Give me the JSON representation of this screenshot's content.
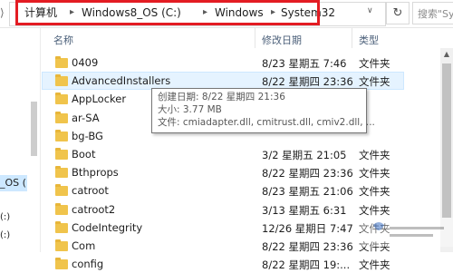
{
  "address_bar": {
    "back_glyph": "⟩",
    "crumbs": [
      "计算机",
      "Windows8_OS (C:)",
      "Windows",
      "System32"
    ],
    "separator": "▸",
    "dropdown_glyph": "∨",
    "refresh_glyph": "↻",
    "search_placeholder": "搜索\"Sy"
  },
  "nav_pane": {
    "drive_label": "_OS (",
    "c_label": "(:)",
    "d_label": "(:)"
  },
  "columns": {
    "name": "名称",
    "date_modified": "修改日期",
    "type": "类型"
  },
  "files": [
    {
      "name": "0409",
      "date": "8/23 星期五 7:46",
      "type": "文件夹"
    },
    {
      "name": "AdvancedInstallers",
      "date": "8/22 星期四 23:36",
      "type": "文件夹"
    },
    {
      "name": "AppLocker",
      "date": "",
      "type": ""
    },
    {
      "name": "ar-SA",
      "date": "",
      "type": ""
    },
    {
      "name": "bg-BG",
      "date": "",
      "type": ""
    },
    {
      "name": "Boot",
      "date": "3/2 星期五 21:05",
      "type": "文件夹"
    },
    {
      "name": "Bthprops",
      "date": "8/22 星期四 23:36",
      "type": "文件夹"
    },
    {
      "name": "catroot",
      "date": "8/23 星期五 21:06",
      "type": "文件夹"
    },
    {
      "name": "catroot2",
      "date": "3/13 星期五 6:31",
      "type": "文件夹"
    },
    {
      "name": "CodeIntegrity",
      "date": "12/26 星期日 7:47",
      "type": "文件夹"
    },
    {
      "name": "Com",
      "date": "8/22 星期四 23:36",
      "type": "文件夹"
    },
    {
      "name": "config",
      "date": "8/22 星期四 19:...",
      "type": "文件夹"
    }
  ],
  "tooltip": {
    "created": "创建日期: 8/22 星期四 21:36",
    "size": "大小: 3.77 MB",
    "files": "文件: cmiadapter.dll, cmitrust.dll, cmiv2.dll, ..."
  },
  "scrollbar": {
    "up_glyph": "▲"
  },
  "colors": {
    "address_highlight": "#e31c23",
    "selection_bg": "#e5f3ff",
    "folder": "#f0c44c",
    "column_header_text": "#4c607a"
  },
  "icons": [
    "folder-icon",
    "refresh-icon",
    "chevron-down-icon",
    "back-arrow-icon"
  ]
}
